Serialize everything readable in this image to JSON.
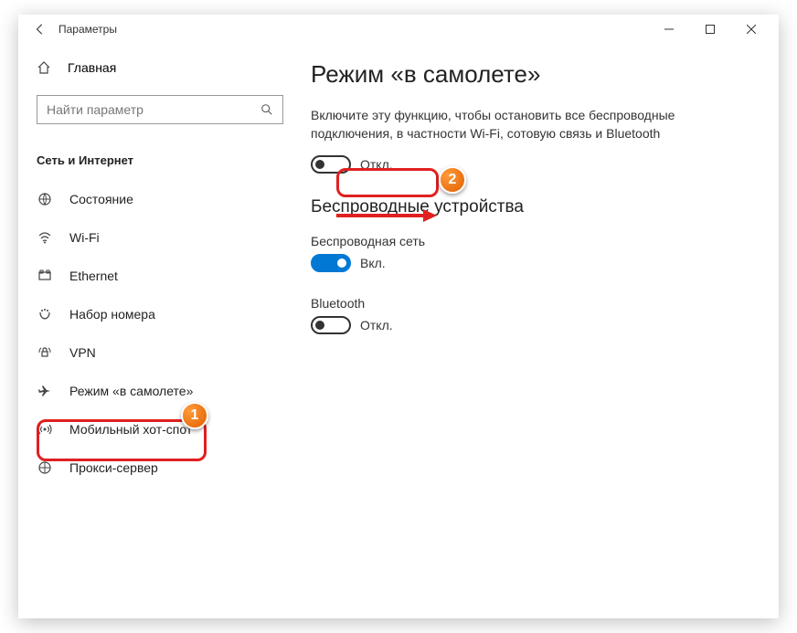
{
  "titlebar": {
    "title": "Параметры"
  },
  "sidebar": {
    "home_label": "Главная",
    "search_placeholder": "Найти параметр",
    "category_label": "Сеть и Интернет",
    "items": [
      {
        "label": "Состояние",
        "icon": "status"
      },
      {
        "label": "Wi-Fi",
        "icon": "wifi"
      },
      {
        "label": "Ethernet",
        "icon": "ethernet"
      },
      {
        "label": "Набор номера",
        "icon": "dialup"
      },
      {
        "label": "VPN",
        "icon": "vpn"
      },
      {
        "label": "Режим «в самолете»",
        "icon": "airplane"
      },
      {
        "label": "Мобильный хот-спот",
        "icon": "hotspot"
      },
      {
        "label": "Прокси-сервер",
        "icon": "proxy"
      }
    ]
  },
  "main": {
    "title": "Режим «в самолете»",
    "description": "Включите эту функцию, чтобы остановить все беспроводные подключения, в частности Wi-Fi, сотовую связь и Bluetooth",
    "airplane_toggle_label": "Откл.",
    "wireless_section": "Беспроводные устройства",
    "wireless_net_label": "Беспроводная сеть",
    "wireless_net_toggle_label": "Вкл.",
    "bluetooth_label": "Bluetooth",
    "bluetooth_toggle_label": "Откл."
  },
  "annotations": {
    "badge1": "1",
    "badge2": "2"
  }
}
